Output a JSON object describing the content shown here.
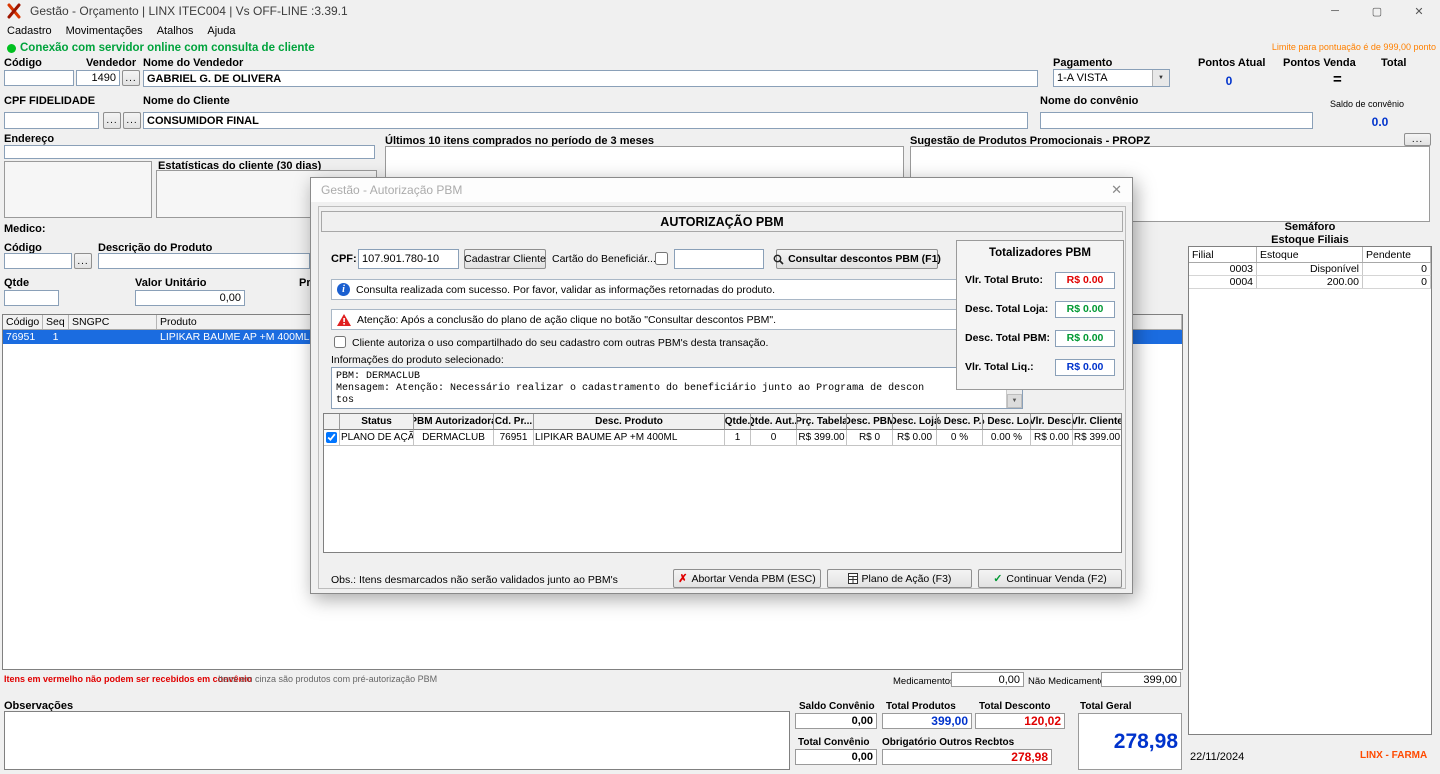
{
  "window": {
    "title": "Gestão - Orçamento  | LINX ITEC004 | Vs OFF-LINE :3.39.1",
    "menu": [
      "Cadastro",
      "Movimentações",
      "Atalhos",
      "Ajuda"
    ],
    "connection_status": "Conexão com servidor online com consulta de cliente",
    "points_limit_note": "Limite para pontuação é de 999,00 ponto"
  },
  "icons": {
    "minimize": "─",
    "maximize": "▢",
    "close": "✕",
    "dropdown": "▼",
    "scroll_up": "▲",
    "scroll_down": "▼",
    "check": "✓",
    "cross": "✗",
    "info": "i",
    "dots": "..."
  },
  "sale_header": {
    "codigo_label": "Código",
    "vendedor_label": "Vendedor",
    "vendedor_value": "1490",
    "nome_vendedor_label": "Nome do Vendedor",
    "nome_vendedor_value": "GABRIEL G. DE OLIVERA",
    "pagamento_label": "Pagamento",
    "pagamento_value": "1-A VISTA",
    "pontos_atual_label": "Pontos Atual",
    "pontos_atual_value": "0",
    "pontos_venda_label": "Pontos Venda",
    "total_label": "Total",
    "equals_sign": "=",
    "cpf_fidelidade_label": "CPF FIDELIDADE",
    "nome_cliente_label": "Nome do Cliente",
    "nome_cliente_value": "CONSUMIDOR FINAL",
    "nome_convenio_label": "Nome do convênio",
    "saldo_convenio_label": "Saldo de convênio",
    "saldo_convenio_value": "0.0",
    "endereco_label": "Endereço",
    "estatisticas_label": "Estatísticas do cliente  (30 dias)",
    "ultimos_itens_label": "Últimos 10 itens comprados no período de 3 meses",
    "sugestao_label": "Sugestão de Produtos Promocionais - PROPZ"
  },
  "product_entry": {
    "medico_label": "Medico:",
    "codigo_label": "Código",
    "descricao_label": "Descrição do Produto",
    "qtde_label": "Qtde",
    "valor_unitario_label": "Valor Unitário",
    "valor_unitario_value": "0,00",
    "pro_label": "Pro"
  },
  "items_grid": {
    "headers": [
      "Código",
      "Seq",
      "SNGPC",
      "Produto"
    ],
    "row": [
      "76951",
      "1",
      "",
      "LIPIKAR BAUME AP +M 400ML"
    ]
  },
  "estoque_panel": {
    "semaforo_label": "Semáforo",
    "title": "Estoque Filiais",
    "headers": [
      "Filial",
      "Estoque",
      "Pendente"
    ],
    "rows": [
      [
        "0003",
        "Disponível",
        "0"
      ],
      [
        "0004",
        "200.00",
        "0"
      ]
    ]
  },
  "pbm_modal": {
    "title": "Gestão - Autorização PBM",
    "header": "AUTORIZAÇÃO PBM",
    "cpf_label": "CPF:",
    "cpf_value": "107.901.780-10",
    "cadastrar_cliente_button": "Cadastrar Cliente",
    "cartao_beneficiario_label": "Cartão do Beneficiár...",
    "consultar_descontos_button": "Consultar descontos PBM (F1)",
    "info_message": "Consulta realizada com sucesso. Por favor, validar as informações retornadas do produto.",
    "warning_message": "Atenção: Após a conclusão do plano de ação clique no botão \"Consultar descontos PBM\".",
    "share_authorization_label": "Cliente autoriza o uso compartilhado do seu cadastro com outras PBM's desta transação.",
    "produto_info_label": "Informações do produto selecionado:",
    "produto_info_line1": "PBM: DERMACLUB",
    "produto_info_line2": "Mensagem: Atenção: Necessário realizar o cadastramento do beneficiário junto ao Programa de descon",
    "produto_info_line3": "tos",
    "totalizadores": {
      "title": "Totalizadores PBM",
      "bruto_label": "Vlr. Total Bruto:",
      "bruto_value": "R$ 0.00",
      "desc_loja_label": "Desc. Total Loja:",
      "desc_loja_value": "R$ 0.00",
      "desc_pbm_label": "Desc. Total PBM:",
      "desc_pbm_value": "R$ 0.00",
      "liq_label": "Vlr. Total Liq.:",
      "liq_value": "R$ 0.00"
    },
    "grid": {
      "headers": [
        "Status",
        "PBM Autorizadora",
        "Cd. Pr...",
        "Desc. Produto",
        "Qtde.",
        "Qtde. Aut...",
        "Prç. Tabela",
        "Desc. PBM",
        "Desc. Loja",
        "% Desc. P...",
        "% Desc. Lo...",
        "Vlr. Desc.",
        "Vlr. Cliente"
      ],
      "row": [
        "PLANO DE AÇÃO",
        "DERMACLUB",
        "76951",
        "LIPIKAR BAUME AP +M 400ML",
        "1",
        "0",
        "R$ 399.00",
        "R$ 0",
        "R$ 0.00",
        "0 %",
        "0.00 %",
        "R$ 0.00",
        "R$ 399.00"
      ]
    },
    "obs_note": "Obs.: Itens desmarcados não serão validados junto ao PBM's",
    "abort_button": "Abortar Venda PBM (ESC)",
    "plano_button": "Plano de Ação (F3)",
    "continue_button": "Continuar Venda (F2)"
  },
  "states": {
    "pbm_row_checked": true,
    "share_checked": false,
    "cartao_checked": false
  },
  "footer": {
    "red_note": "Itens em vermelho não podem ser recebidos em convênio",
    "gray_note": "Itens em cinza são produtos com pré-autorização PBM",
    "medicamentos_label": "Medicamentos",
    "medicamentos_value": "0,00",
    "nao_medicamentos_label": "Não Medicamentos",
    "nao_medicamentos_value": "399,00",
    "observacoes_label": "Observações",
    "saldo_convenio_label": "Saldo Convênio",
    "saldo_convenio_value": "0,00",
    "total_produtos_label": "Total Produtos",
    "total_produtos_value": "399,00",
    "total_desconto_label": "Total Desconto",
    "total_desconto_value": "120,02",
    "total_geral_label": "Total Geral",
    "total_geral_value": "278,98",
    "total_convenio_label": "Total Convênio",
    "total_convenio_value": "0,00",
    "obrigatorio_label": "Obrigatório Outros Recbtos",
    "obrigatorio_value": "278,98",
    "date": "22/11/2024",
    "brand": "LINX - FARMA"
  }
}
